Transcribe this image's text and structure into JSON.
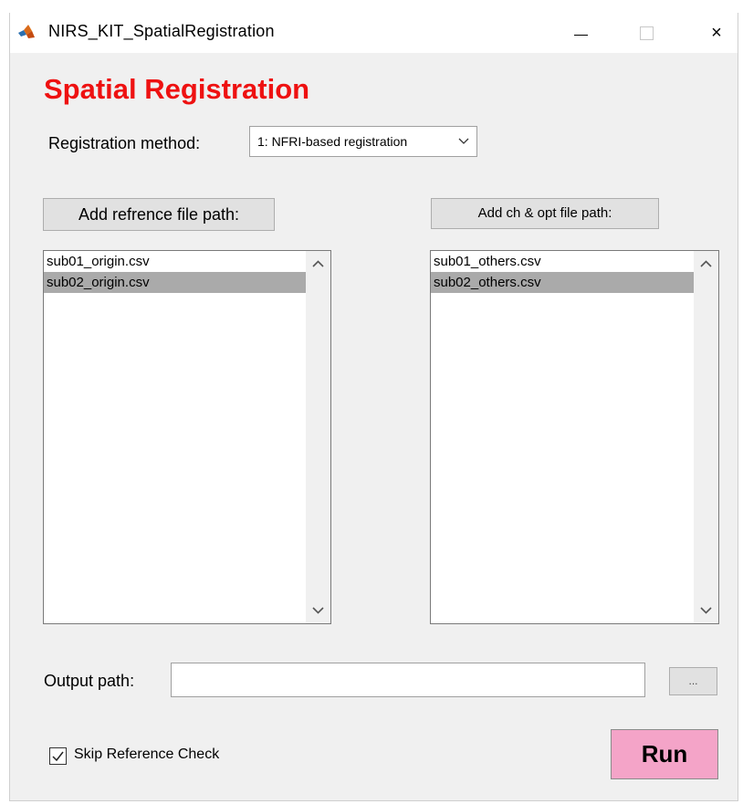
{
  "window": {
    "title": "NIRS_KIT_SpatialRegistration",
    "controls": {
      "minimize": "minimize",
      "maximize": "maximize",
      "close": "×"
    }
  },
  "heading": "Spatial Registration",
  "registration": {
    "label": "Registration method:",
    "selected": "1: NFRI-based registration"
  },
  "reference": {
    "button_label": "Add refrence file path:",
    "files": [
      "sub01_origin.csv",
      "sub02_origin.csv"
    ],
    "selected_index": 1
  },
  "channels": {
    "button_label": "Add ch & opt file path:",
    "files": [
      "sub01_others.csv",
      "sub02_others.csv"
    ],
    "selected_index": 1
  },
  "output": {
    "label": "Output path:",
    "value": "",
    "browse_label": "..."
  },
  "skip_check": {
    "label": "Skip Reference Check",
    "checked": true
  },
  "run_label": "Run",
  "colors": {
    "heading": "#ee1111",
    "run_button": "#f4a4c8",
    "selection": "#aaaaaa",
    "window_bg": "#f0f0f0"
  },
  "icons": [
    "matlab-icon",
    "chevron-down-icon",
    "scroll-up-icon",
    "scroll-down-icon",
    "checkmark-icon"
  ]
}
